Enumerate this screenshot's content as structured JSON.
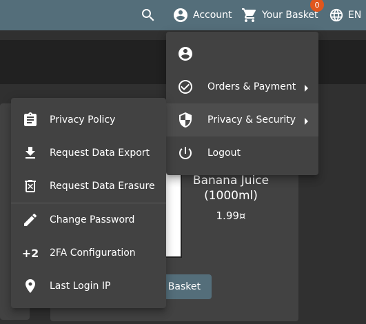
{
  "toolbar": {
    "search_icon": "search-icon",
    "account_label": "Account",
    "basket_label": "Your Basket",
    "basket_count": "0",
    "language_label": "EN"
  },
  "account_menu": {
    "items": [
      {
        "label": "",
        "icon": "account-circle-icon"
      },
      {
        "label": "Orders & Payment",
        "icon": "check-circle-icon"
      },
      {
        "label": "Privacy & Security",
        "icon": "shield-icon"
      },
      {
        "label": "Logout",
        "icon": "power-icon"
      }
    ]
  },
  "privacy_menu": {
    "items": [
      {
        "label": "Privacy Policy",
        "icon": "clipboard-icon"
      },
      {
        "label": "Request Data Export",
        "icon": "download-icon"
      },
      {
        "label": "Request Data Erasure",
        "icon": "delete-icon"
      },
      {
        "label": "Change Password",
        "icon": "pencil-icon"
      },
      {
        "label": "2FA Configuration",
        "icon": "plus-two-icon",
        "icon_text": "+2"
      },
      {
        "label": "Last Login IP",
        "icon": "location-pin-icon"
      }
    ]
  },
  "product": {
    "name": "Banana Juice (1000ml)",
    "price": "1.99¤",
    "add_button_label": "Basket"
  },
  "colors": {
    "toolbar": "#546e7a",
    "background": "#303030",
    "menu": "#424242",
    "badge": "#e0561d"
  }
}
